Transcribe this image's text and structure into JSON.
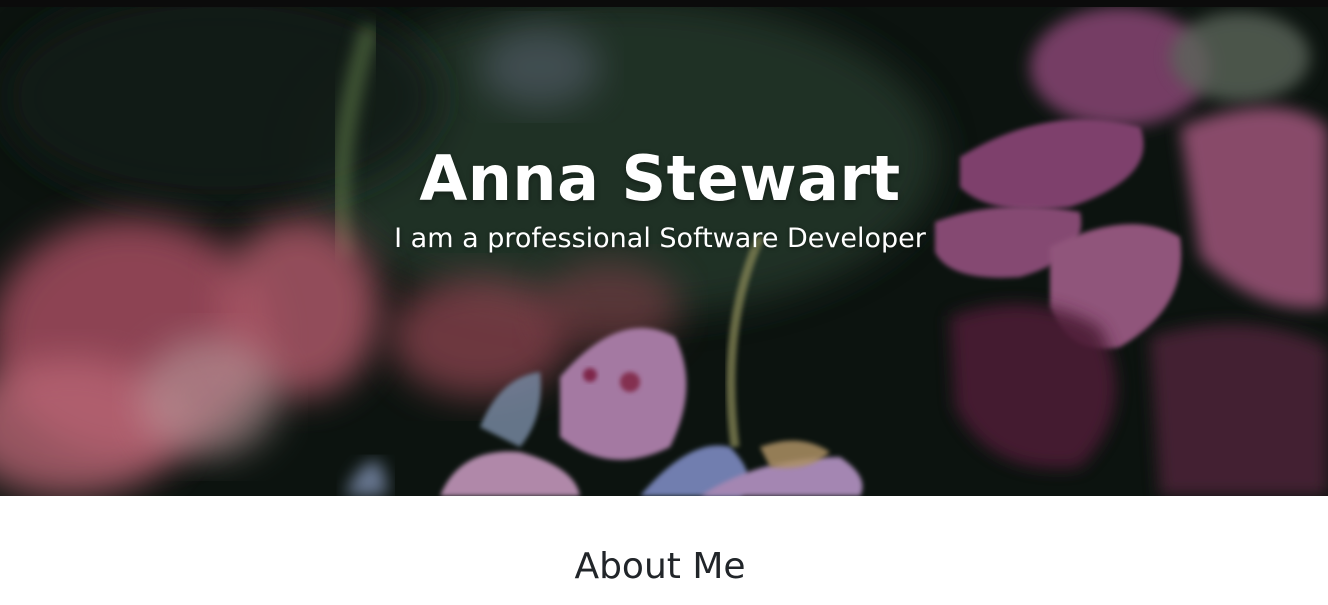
{
  "hero": {
    "title": "Anna Stewart",
    "subtitle": "I am a professional Software Developer",
    "background_image": "flowers-photo"
  },
  "about": {
    "heading": "About Me"
  },
  "colors": {
    "heading_text": "#212529",
    "hero_text": "#ffffff",
    "page_background": "#ffffff"
  }
}
